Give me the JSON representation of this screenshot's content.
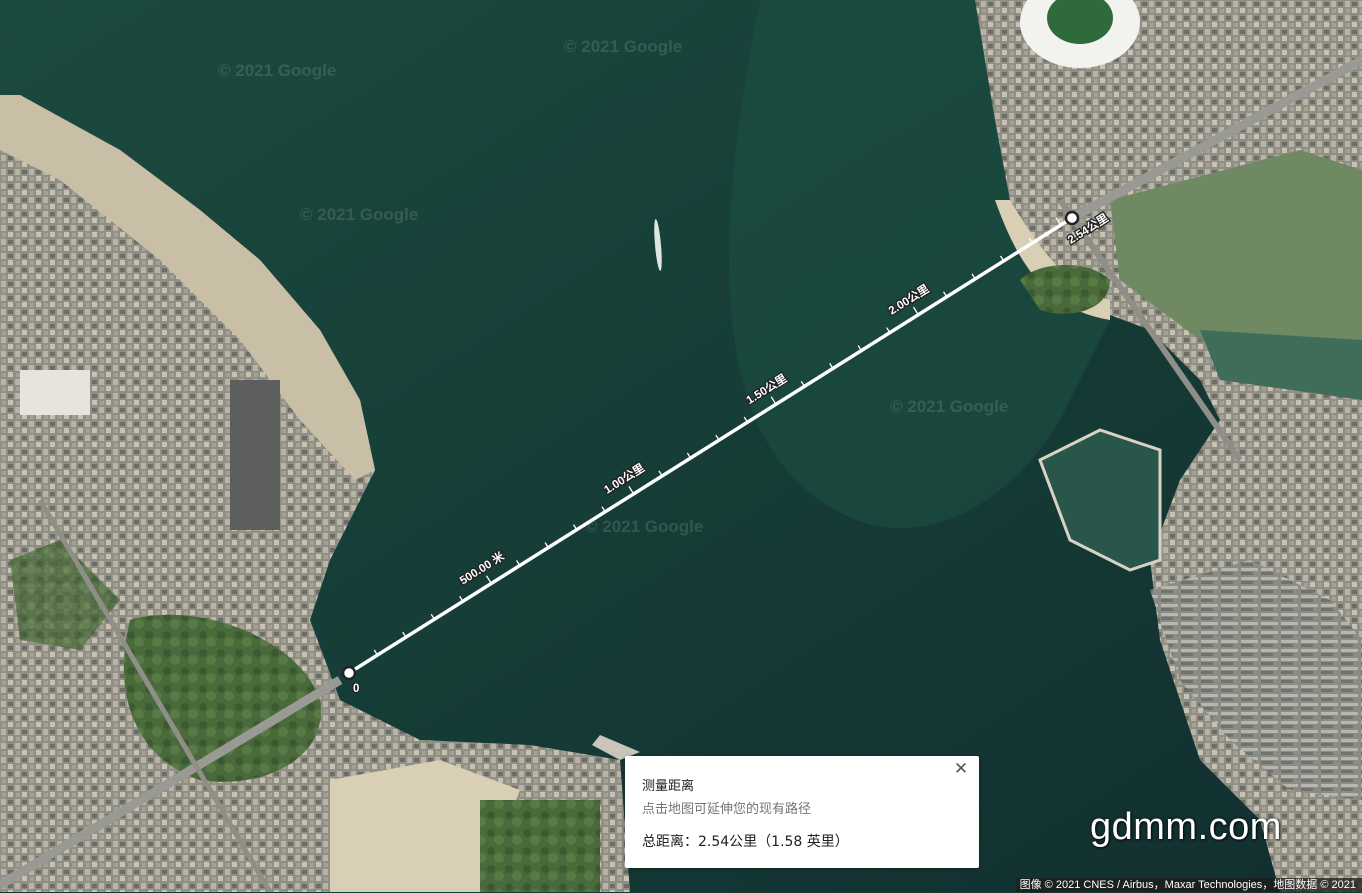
{
  "map": {
    "watermarks": [
      "© 2021 Google",
      "© 2021 Google",
      "© 2021 Google",
      "© 2021 Google",
      "© 2021 Google"
    ],
    "site_watermark": "gdmm.com",
    "attribution": "图像 © 2021 CNES / Airbus，Maxar Technologies，地图数据 © 2021"
  },
  "measurement": {
    "start_label": "0",
    "end_label": "2.54公里",
    "marker_labels": [
      "500.00 米",
      "1.00公里",
      "1.50公里",
      "2.00公里"
    ],
    "marker_values_km": [
      0.5,
      1.0,
      1.5,
      2.0
    ],
    "total_km": 2.54
  },
  "panel": {
    "title": "测量距离",
    "hint": "点击地图可延伸您的现有路径",
    "total": "总距离：2.54公里（1.58 英里）",
    "close_icon": "close-icon"
  }
}
